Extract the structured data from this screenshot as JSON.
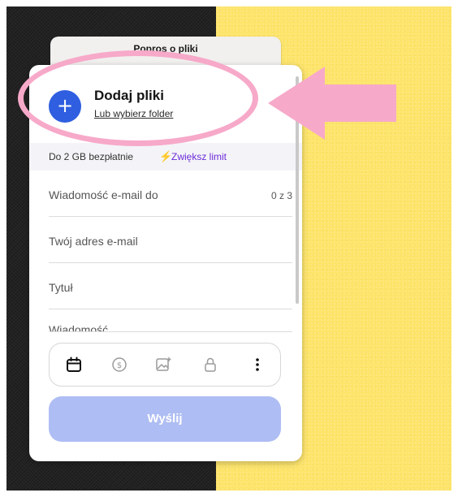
{
  "back_card": {
    "label": "Popros o pliki"
  },
  "upload": {
    "add_title": "Dodaj pliki",
    "folder_link": "Lub wybierz folder"
  },
  "limit": {
    "text": "Do 2 GB bezpłatnie",
    "upgrade_link": "Zwiększ limit",
    "accent_color": "#6c2bd9"
  },
  "fields": {
    "email_to": {
      "label": "Wiadomość e-mail do",
      "counter": "0 z 3"
    },
    "your_email": {
      "label": "Twój adres e-mail"
    },
    "title": {
      "label": "Tytuł"
    },
    "message": {
      "label": "Wiadomość"
    }
  },
  "toolbar": {
    "icons": [
      "calendar-icon",
      "dollar-icon",
      "image-icon",
      "lock-icon",
      "more-vertical-icon"
    ]
  },
  "send_button": {
    "label": "Wyślij",
    "color": "#aebdf3"
  },
  "colors": {
    "primary_blue": "#2f5fe0",
    "background_yellow": "#fde46a",
    "background_dark": "#232323",
    "annotation_pink": "#f7a9c9"
  }
}
